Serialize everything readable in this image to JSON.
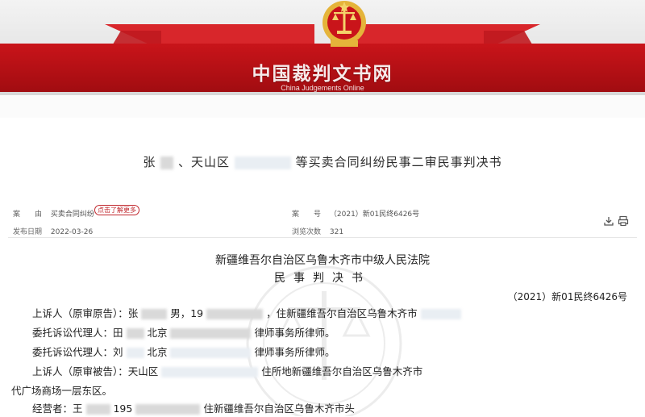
{
  "header": {
    "site_title": "中国裁判文书网",
    "site_subtitle": "China Judgements Online",
    "colors": {
      "banner_red": "#c9141a",
      "emblem_gold": "#e5b43a"
    }
  },
  "document": {
    "title_visible_start": "张",
    "title_visible_sep": "、天山区",
    "title_visible_end": "等买卖合同纠纷民事二审民事判决书",
    "meta": {
      "cause_label": "案　　由",
      "cause_value": "买卖合同纠纷",
      "cause_link": "点击了解更多",
      "case_no_label": "案　　号",
      "case_no_value": "（2021）新01民终6426号",
      "publish_label": "发布日期",
      "publish_value": "2022-03-26",
      "views_label": "浏览次数",
      "views_value": "321"
    },
    "toolbar": {
      "save_icon": "save-icon",
      "print_icon": "print-icon"
    },
    "court_name": "新疆维吾尔自治区乌鲁木齐市中级人民法院",
    "doc_type": "民事判决书",
    "case_number": "（2021）新01民终6426号",
    "parties": [
      {
        "prefix": "上诉人（原审原告）：张",
        "mid": "男，19",
        "suffix": "，住新疆维吾尔自治区乌鲁木齐市"
      },
      {
        "prefix": "委托诉讼代理人：田",
        "mid": "北京",
        "suffix": "律师事务所律师。"
      },
      {
        "prefix": "委托诉讼代理人：刘",
        "mid": "北京",
        "suffix": "律师事务所律师。"
      },
      {
        "prefix": "上诉人（原审被告）：天山区",
        "mid": "",
        "suffix": "住所地新疆维吾尔自治区乌鲁木齐市"
      },
      {
        "prefix": "代广场商场一层东区。",
        "mid": "",
        "suffix": ""
      },
      {
        "prefix": "经营者：王",
        "mid": "195",
        "suffix": "住新疆维吾尔自治区乌鲁木齐市头"
      }
    ]
  }
}
